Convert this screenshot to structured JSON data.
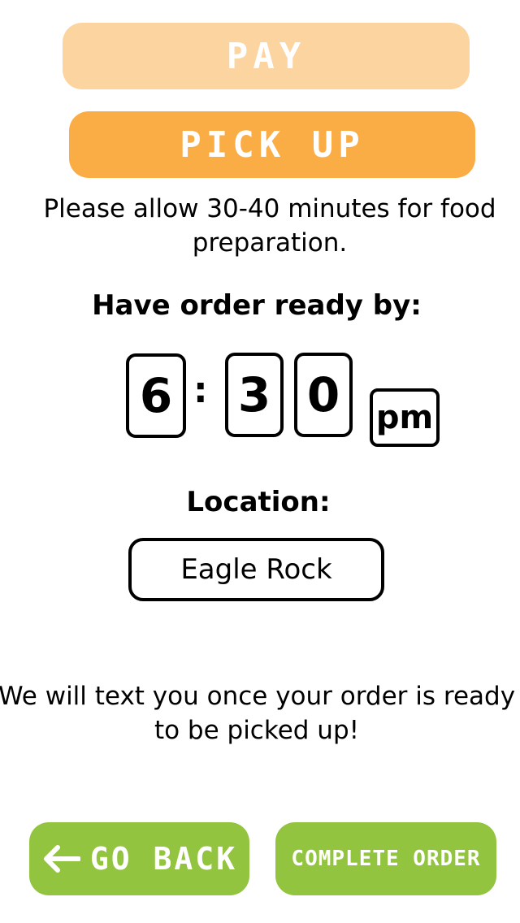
{
  "tabs": {
    "pay_label": "PAY",
    "pickup_label": "PICK UP"
  },
  "prep_note": "Please allow 30-40 minutes for food preparation.",
  "ready_time": {
    "heading": "Have order ready by:",
    "hour": "6",
    "separator": ":",
    "minute_tens": "3",
    "minute_ones": "0",
    "period": "pm"
  },
  "location": {
    "heading": "Location:",
    "value": "Eagle Rock"
  },
  "text_note": "We will text you once your order is ready to be picked up!",
  "actions": {
    "back_label": "GO BACK",
    "back_icon": "arrow-left-icon",
    "complete_label": "COMPLETE ORDER"
  },
  "colors": {
    "pay_tab": "#fcd49f",
    "pickup_tab": "#fbad45",
    "action_green": "#93c43f"
  }
}
